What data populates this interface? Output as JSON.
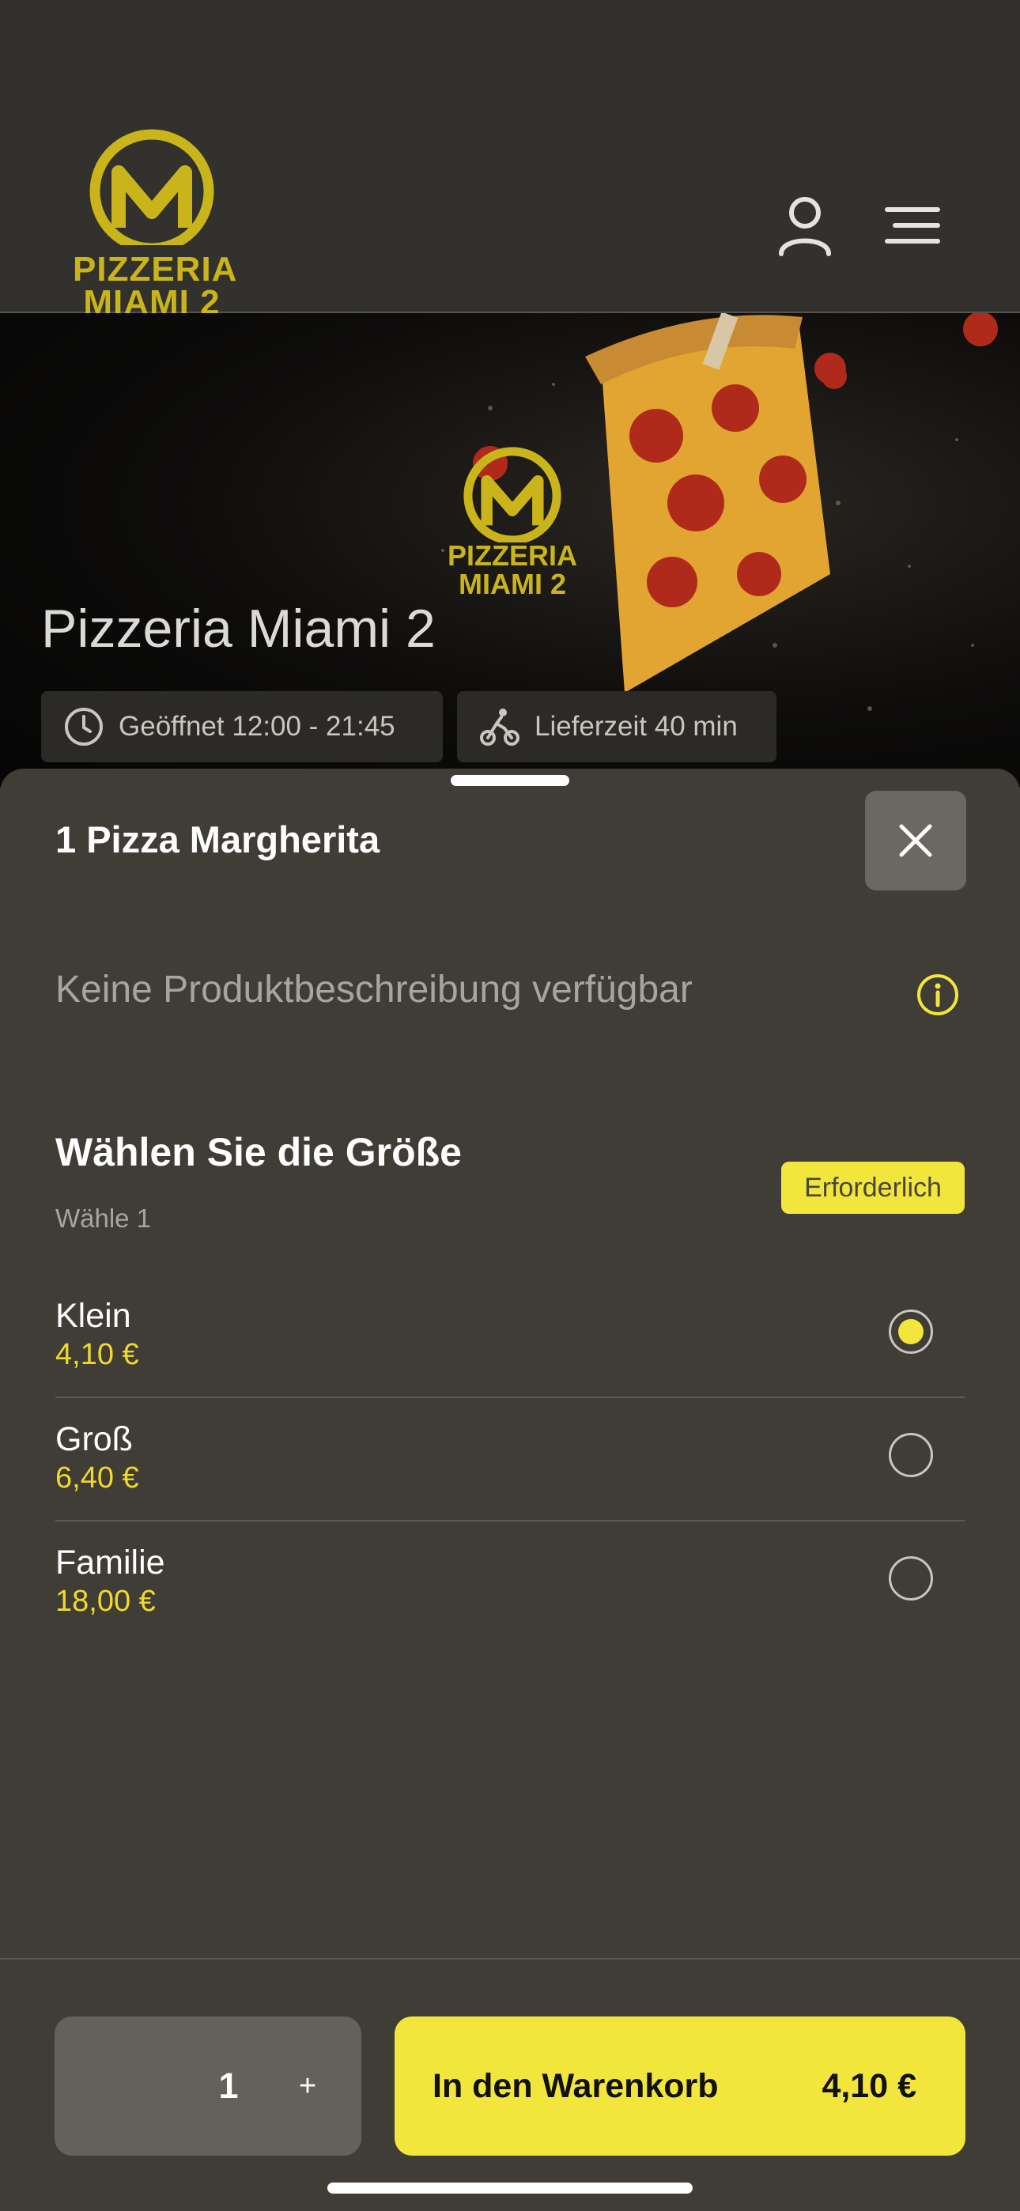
{
  "header": {
    "logo_line1": "PIZZERIA",
    "logo_line2": "MIAMI 2",
    "account_icon": "user-icon",
    "menu_icon": "hamburger-menu-icon"
  },
  "hero": {
    "title": "Pizzeria Miami 2",
    "opening_hours": "Geöffnet 12:00 - 21:45",
    "delivery_time": "Lieferzeit 40 min",
    "logo_line1": "PIZZERIA",
    "logo_line2": "MIAMI 2"
  },
  "sheet": {
    "title": "1 Pizza Margherita",
    "description": "Keine Produktbeschreibung verfügbar",
    "size_heading": "Wählen Sie die Größe",
    "size_subtitle": "Wähle 1",
    "required_badge": "Erforderlich",
    "options": [
      {
        "name": "Klein",
        "price": "4,10 €",
        "selected": true
      },
      {
        "name": "Groß",
        "price": "6,40 €",
        "selected": false
      },
      {
        "name": "Familie",
        "price": "18,00 €",
        "selected": false
      }
    ]
  },
  "footer": {
    "quantity": "1",
    "plus": "+",
    "cart_label": "In den Warenkorb",
    "cart_price": "4,10 €"
  },
  "colors": {
    "accent": "#f2e63d",
    "price": "#f0d92d",
    "background": "#403c36",
    "logo": "#c9b41b"
  }
}
